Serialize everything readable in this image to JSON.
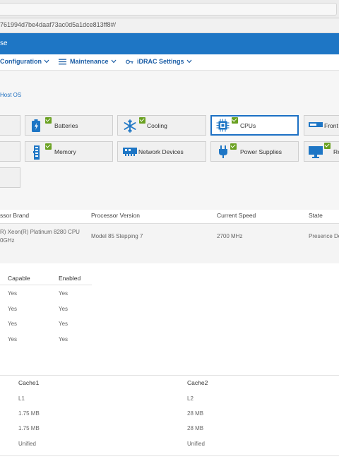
{
  "browser": {
    "url": "l761994d7be4daaf73ac0d5a1dce813ff8#/"
  },
  "app": {
    "title_fragment": "se"
  },
  "nav": {
    "configuration": "Configuration",
    "maintenance": "Maintenance",
    "idrac_settings": "iDRAC Settings"
  },
  "breadcrumb": {
    "last": "Host OS"
  },
  "tiles": {
    "batteries": "Batteries",
    "cooling": "Cooling",
    "cpus": "CPUs",
    "front": "Front",
    "memory": "Memory",
    "network": "Network Devices",
    "power": "Power Supplies",
    "re": "Re"
  },
  "processor_table": {
    "headers": [
      "ssor Brand",
      "Processor Version",
      "Current Speed",
      "State"
    ],
    "row": {
      "brand_line1": "R) Xeon(R) Platinum 8280 CPU",
      "brand_line2": "0GHz",
      "version": "Model 85 Stepping 7",
      "speed": "2700 MHz",
      "state": "Presence De"
    }
  },
  "capabilities": {
    "headers": [
      "Capable",
      "Enabled"
    ],
    "rows": [
      [
        "Yes",
        "Yes"
      ],
      [
        "Yes",
        "Yes"
      ],
      [
        "Yes",
        "Yes"
      ],
      [
        "Yes",
        "Yes"
      ]
    ]
  },
  "cache": {
    "headers": [
      "Cache1",
      "Cache2"
    ],
    "rows": [
      [
        "L1",
        "L2"
      ],
      [
        "1.75 MB",
        "28 MB"
      ],
      [
        "1.75 MB",
        "28 MB"
      ],
      [
        "Unified",
        "Unified"
      ]
    ]
  },
  "colors": {
    "accent": "#1e76c5",
    "check": "#6aa121",
    "link": "#1e5fa6"
  }
}
